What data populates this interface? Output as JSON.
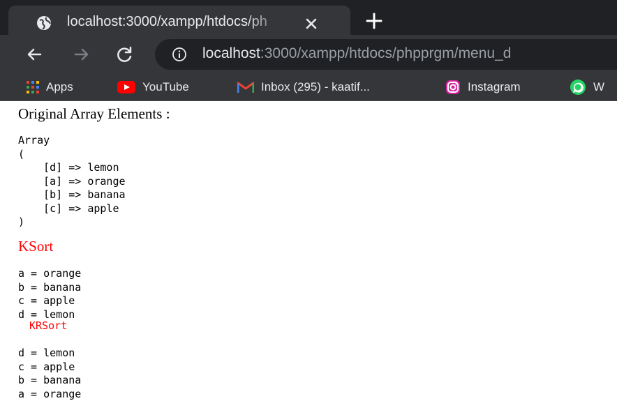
{
  "browser": {
    "tab": {
      "title": "localhost:3000/xampp/htdocs/ph"
    },
    "address": {
      "host": "localhost",
      "rest": ":3000/xampp/htdocs/phpprgm/menu_d"
    },
    "bookmarks": [
      {
        "label": "Apps",
        "icon": "apps-grid-icon"
      },
      {
        "label": "YouTube",
        "icon": "youtube-icon"
      },
      {
        "label": "Inbox (295) - kaatif...",
        "icon": "gmail-icon"
      },
      {
        "label": "Instagram",
        "icon": "instagram-icon"
      },
      {
        "label": "W",
        "icon": "whatsapp-icon"
      }
    ]
  },
  "page": {
    "original_heading": "Original Array Elements :",
    "array_dump": "Array\n(\n    [d] => lemon\n    [a] => orange\n    [b] => banana\n    [c] => apple\n)",
    "ksort_heading": "KSort",
    "ksort_output": "a = orange\nb = banana\nc = apple\nd = lemon",
    "krsort_heading": "KRSort",
    "krsort_output": "d = lemon\nc = apple\nb = banana\na = orange"
  },
  "colors": {
    "chrome_dark": "#202124",
    "chrome_toolbar": "#35363a",
    "heading_red": "#ff0000"
  }
}
